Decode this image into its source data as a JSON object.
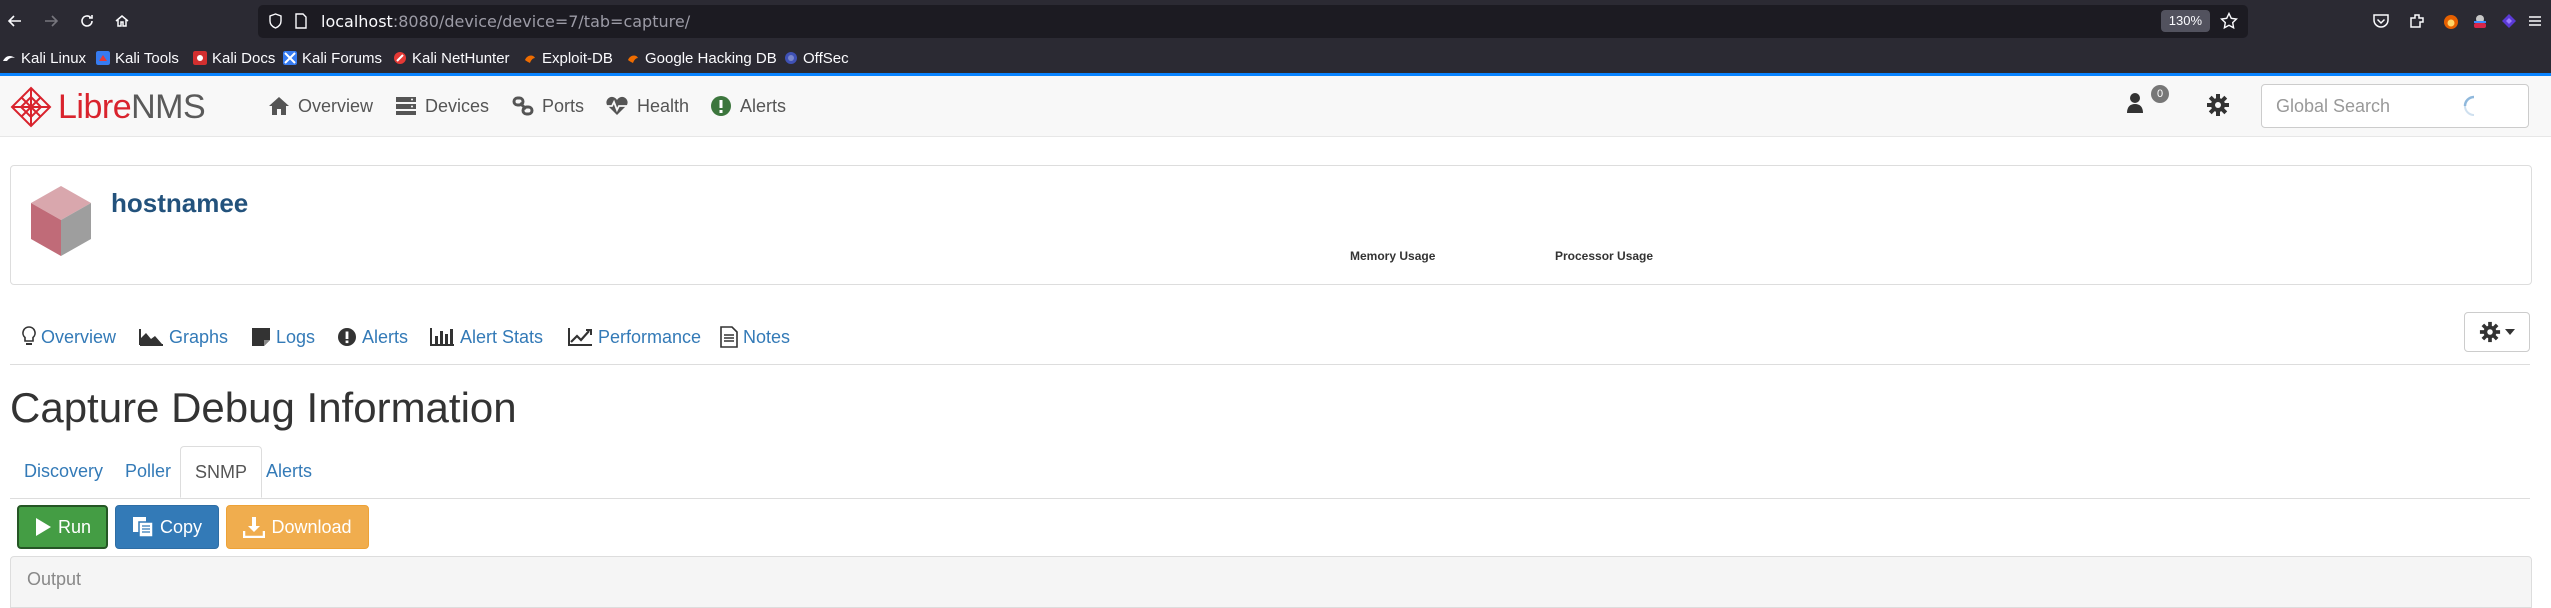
{
  "browser": {
    "url_host": "localhost",
    "url_path": ":8080/device/device=7/tab=capture/",
    "zoom": "130%",
    "bookmarks": [
      {
        "label": "Kali Linux"
      },
      {
        "label": "Kali Tools"
      },
      {
        "label": "Kali Docs"
      },
      {
        "label": "Kali Forums"
      },
      {
        "label": "Kali NetHunter"
      },
      {
        "label": "Exploit-DB"
      },
      {
        "label": "Google Hacking DB"
      },
      {
        "label": "OffSec"
      }
    ]
  },
  "app": {
    "logo_libre": "Libre",
    "logo_nms": "NMS",
    "nav": [
      {
        "label": "Overview"
      },
      {
        "label": "Devices"
      },
      {
        "label": "Ports"
      },
      {
        "label": "Health"
      },
      {
        "label": "Alerts"
      }
    ],
    "notification_count": "0",
    "search_placeholder": "Global Search"
  },
  "device": {
    "hostname": "hostnamee",
    "memory_label": "Memory Usage",
    "processor_label": "Processor Usage",
    "tabs": [
      {
        "label": "Overview"
      },
      {
        "label": "Graphs"
      },
      {
        "label": "Logs"
      },
      {
        "label": "Alerts"
      },
      {
        "label": "Alert Stats"
      },
      {
        "label": "Performance"
      },
      {
        "label": "Notes"
      }
    ]
  },
  "capture": {
    "title": "Capture Debug Information",
    "tabs": [
      {
        "label": "Discovery"
      },
      {
        "label": "Poller"
      },
      {
        "label": "SNMP",
        "active": true
      },
      {
        "label": "Alerts"
      }
    ],
    "run_label": "Run",
    "copy_label": "Copy",
    "download_label": "Download",
    "output_title": "Output"
  },
  "colors": {
    "link": "#337ab7",
    "brand_red": "#d9232d",
    "success": "#449d44",
    "primary": "#337ab7",
    "warning": "#f0ad4e"
  }
}
